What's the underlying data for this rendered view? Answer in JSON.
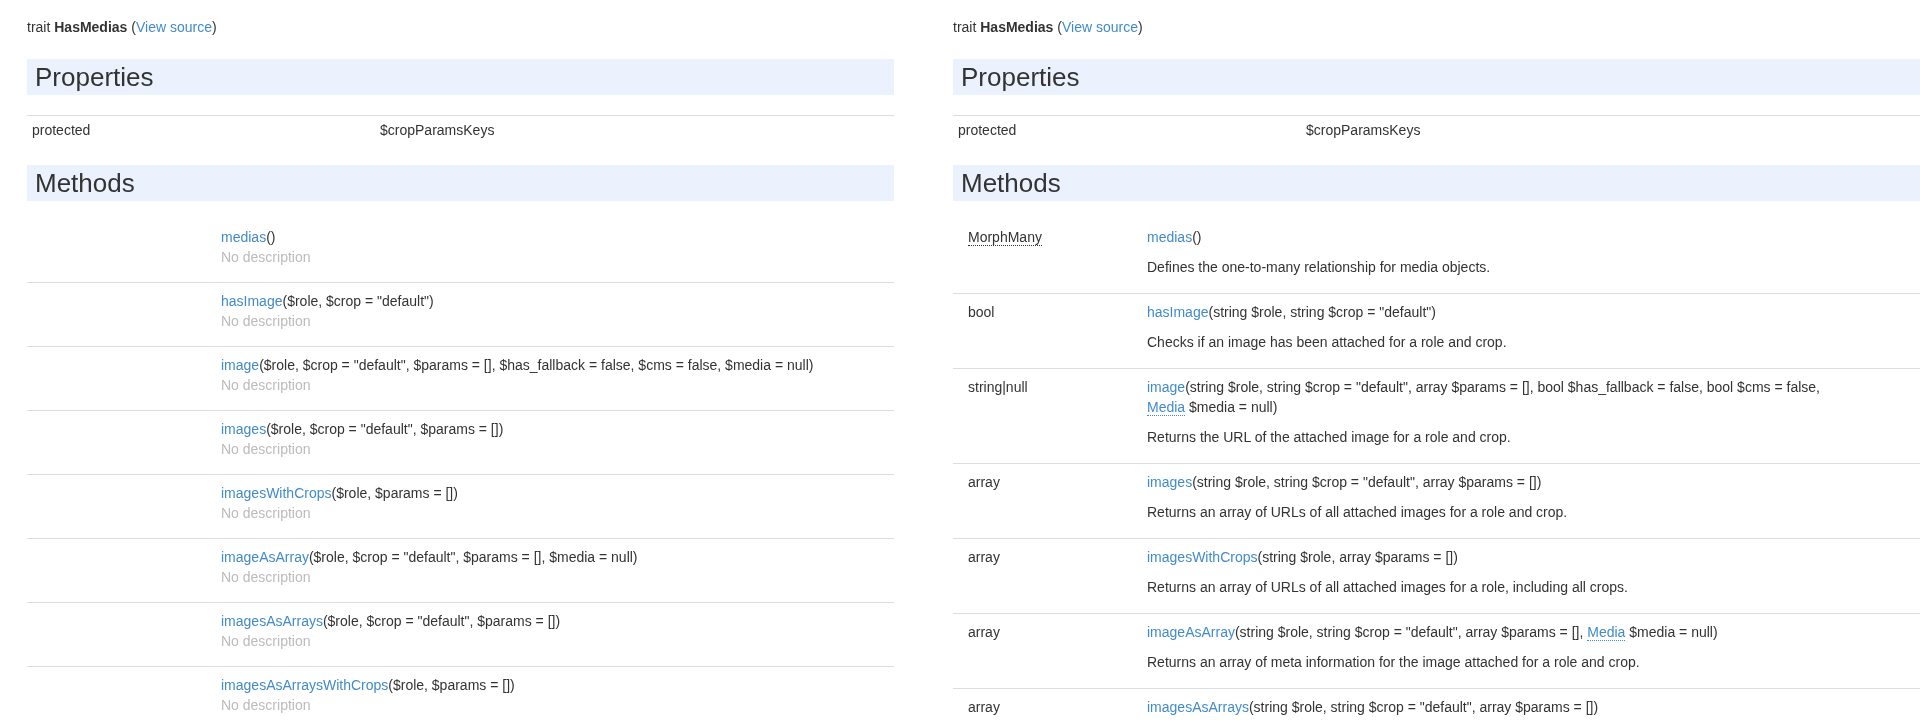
{
  "panels": [
    {
      "header": {
        "before": "trait **HasMedias** (",
        "link": "View source",
        "after": ")"
      },
      "properties": {
        "heading": "Properties",
        "rows": [
          {
            "visibility": "protected",
            "name": "$cropParamsKeys"
          }
        ]
      },
      "methods": {
        "heading": "Methods",
        "rows": [
          {
            "name": "medias",
            "signature": [
              {
                "kind": "text",
                "text": "()"
              }
            ],
            "description": {
              "kind": "missing",
              "text": "No description"
            }
          },
          {
            "name": "hasImage",
            "signature": [
              {
                "kind": "text",
                "text": "($role, $crop = \"default\")"
              }
            ],
            "description": {
              "kind": "missing",
              "text": "No description"
            }
          },
          {
            "name": "image",
            "signature": [
              {
                "kind": "text",
                "text": "($role, $crop = \"default\", $params = [], $has_fallback = false, $cms = false, $media = null)"
              }
            ],
            "description": {
              "kind": "missing",
              "text": "No description"
            }
          },
          {
            "name": "images",
            "signature": [
              {
                "kind": "text",
                "text": "($role, $crop = \"default\", $params = [])"
              }
            ],
            "description": {
              "kind": "missing",
              "text": "No description"
            }
          },
          {
            "name": "imagesWithCrops",
            "signature": [
              {
                "kind": "text",
                "text": "($role, $params = [])"
              }
            ],
            "description": {
              "kind": "missing",
              "text": "No description"
            }
          },
          {
            "name": "imageAsArray",
            "signature": [
              {
                "kind": "text",
                "text": "($role, $crop = \"default\", $params = [], $media = null)"
              }
            ],
            "description": {
              "kind": "missing",
              "text": "No description"
            }
          },
          {
            "name": "imagesAsArrays",
            "signature": [
              {
                "kind": "text",
                "text": "($role, $crop = \"default\", $params = [])"
              }
            ],
            "description": {
              "kind": "missing",
              "text": "No description"
            }
          },
          {
            "name": "imagesAsArraysWithCrops",
            "signature": [
              {
                "kind": "text",
                "text": "($role, $params = [])"
              }
            ],
            "description": {
              "kind": "missing",
              "text": "No description"
            }
          }
        ]
      }
    },
    {
      "header": {
        "before": "trait **HasMedias** (",
        "link": "View source",
        "after": ")"
      },
      "properties": {
        "heading": "Properties",
        "rows": [
          {
            "visibility": "protected",
            "name": "$cropParamsKeys"
          }
        ]
      },
      "methods": {
        "heading": "Methods",
        "rows": [
          {
            "return_type": {
              "kind": "abbr",
              "text": "MorphMany"
            },
            "name": "medias",
            "signature": [
              {
                "kind": "text",
                "text": "()"
              }
            ],
            "description": {
              "kind": "given",
              "text": "Defines the one-to-many relationship for media objects."
            }
          },
          {
            "return_type": {
              "kind": "plain",
              "text": "bool"
            },
            "name": "hasImage",
            "signature": [
              {
                "kind": "text",
                "text": "(string $role, string $crop = \"default\")"
              }
            ],
            "description": {
              "kind": "given",
              "text": "Checks if an image has been attached for a role and crop."
            }
          },
          {
            "return_type": {
              "kind": "plain",
              "text": "string|null"
            },
            "name": "image",
            "signature": [
              {
                "kind": "text",
                "text": "(string $role, string $crop = \"default\", array $params = [], bool $has_fallback = false, bool $cms = false, "
              },
              {
                "kind": "type_link",
                "text": "Media"
              },
              {
                "kind": "text",
                "text": " $media = null)"
              }
            ],
            "description": {
              "kind": "given",
              "text": "Returns the URL of the attached image for a role and crop."
            }
          },
          {
            "return_type": {
              "kind": "plain",
              "text": "array"
            },
            "name": "images",
            "signature": [
              {
                "kind": "text",
                "text": "(string $role, string $crop = \"default\", array $params = [])"
              }
            ],
            "description": {
              "kind": "given",
              "text": "Returns an array of URLs of all attached images for a role and crop."
            }
          },
          {
            "return_type": {
              "kind": "plain",
              "text": "array"
            },
            "name": "imagesWithCrops",
            "signature": [
              {
                "kind": "text",
                "text": "(string $role, array $params = [])"
              }
            ],
            "description": {
              "kind": "given",
              "text": "Returns an array of URLs of all attached images for a role, including all crops."
            }
          },
          {
            "return_type": {
              "kind": "plain",
              "text": "array"
            },
            "name": "imageAsArray",
            "signature": [
              {
                "kind": "text",
                "text": "(string $role, string $crop = \"default\", array $params = [], "
              },
              {
                "kind": "type_link",
                "text": "Media"
              },
              {
                "kind": "text",
                "text": " $media = null)"
              }
            ],
            "description": {
              "kind": "given",
              "text": "Returns an array of meta information for the image attached for a role and crop."
            }
          },
          {
            "return_type": {
              "kind": "plain",
              "text": "array"
            },
            "name": "imagesAsArrays",
            "signature": [
              {
                "kind": "text",
                "text": "(string $role, string $crop = \"default\", array $params = [])"
              }
            ]
          }
        ]
      }
    }
  ]
}
